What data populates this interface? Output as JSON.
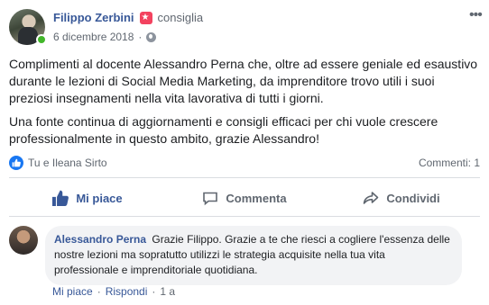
{
  "post": {
    "author": "Filippo Zerbini",
    "recommend_icon": "star-icon",
    "recommend_word": "consiglia",
    "date": "6 dicembre 2018",
    "privacy_icon": "globe-icon",
    "more_icon": "ellipsis-icon",
    "paragraph_1": "Complimenti al docente Alessandro Perna che, oltre ad essere geniale ed esaustivo durante le lezioni di Social Media Marketing, da imprenditore trovo utili i suoi preziosi insegnamenti nella vita lavorativa di tutti i giorni.",
    "paragraph_2": "Una fonte continua di aggiornamenti e consigli efficaci per chi vuole crescere professionalmente in questo ambito, grazie Alessandro!"
  },
  "reactions": {
    "icon": "like-icon",
    "names": "Tu e Ileana Sirto",
    "comments_count": "Commenti: 1"
  },
  "actions": {
    "like": "Mi piace",
    "comment": "Commenta",
    "share": "Condividi"
  },
  "comment": {
    "author": "Alessandro Perna",
    "text": "Grazie Filippo. Grazie a te che riesci a cogliere l'essenza delle nostre lezioni ma sopratutto utilizzi le strategia acquisite nella tua vita professionale e imprenditoriale quotidiana.",
    "like": "Mi piace",
    "reply": "Rispondi",
    "time": "1 a"
  },
  "colors": {
    "link_blue": "#385898",
    "like_blue": "#1877f2",
    "online_green": "#42b72a",
    "recommend_red": "#f3425f",
    "muted_gray": "#606770",
    "bubble_gray": "#f2f3f5"
  }
}
